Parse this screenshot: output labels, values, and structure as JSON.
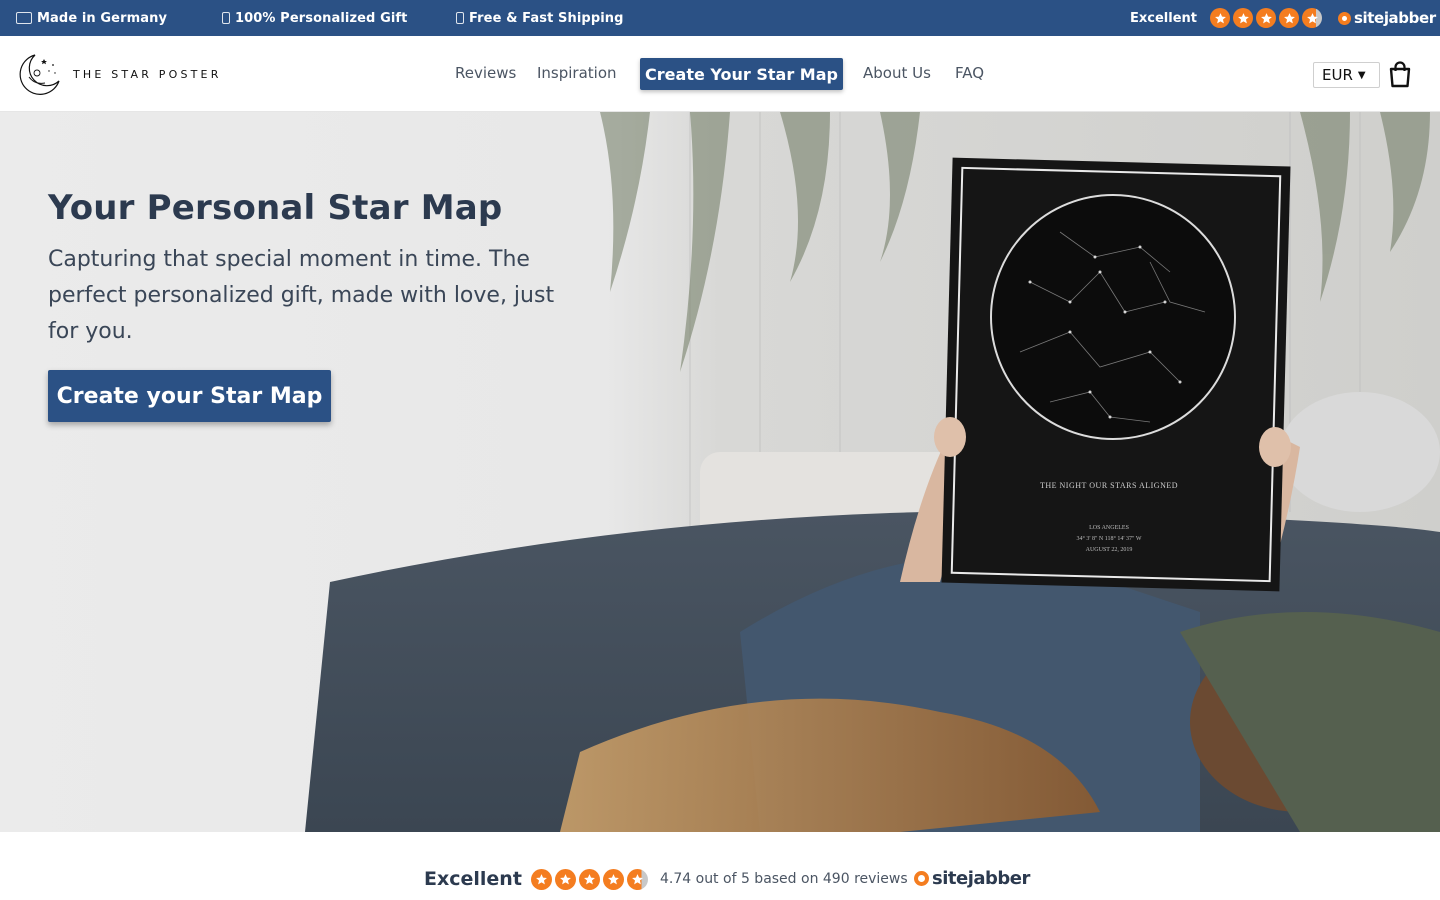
{
  "announcement_bar": {
    "items": [
      {
        "icon": "germany-flag-icon",
        "label": "Made in Germany"
      },
      {
        "icon": "gift-icon",
        "label": "100% Personalized Gift"
      },
      {
        "icon": "truck-icon",
        "label": "Free & Fast Shipping"
      }
    ],
    "rating_label": "Excellent",
    "stars": 4.74,
    "rating_logo": "sitejabber"
  },
  "header": {
    "brand_name": "THE STAR POSTER",
    "nav": [
      "Reviews",
      "Inspiration",
      "Create Your Star Map",
      "About Us",
      "FAQ"
    ],
    "currency": "EUR",
    "cart_icon": "shopping-bag-icon"
  },
  "hero": {
    "title": "Your Personal Star Map",
    "subtitle": "Capturing that special moment in time. The perfect personalized gift, made with love, just for you.",
    "cta_label": "Create your Star Map",
    "poster_caption": "THE NIGHT OUR STARS ALIGNED",
    "poster_location": "LOS ANGELES",
    "poster_coordinates": "34° 3' 8\" N 118° 14' 37\" W",
    "poster_date": "AUGUST 22, 2019"
  },
  "rating_strip": {
    "label": "Excellent",
    "stars": 4.74,
    "summary": "4.74 out of 5 based on 490 reviews",
    "logo": "sitejabber"
  },
  "colors": {
    "brand_blue": "#2b5185",
    "star_orange": "#f47d20",
    "text_dark": "#2c3a4f"
  }
}
